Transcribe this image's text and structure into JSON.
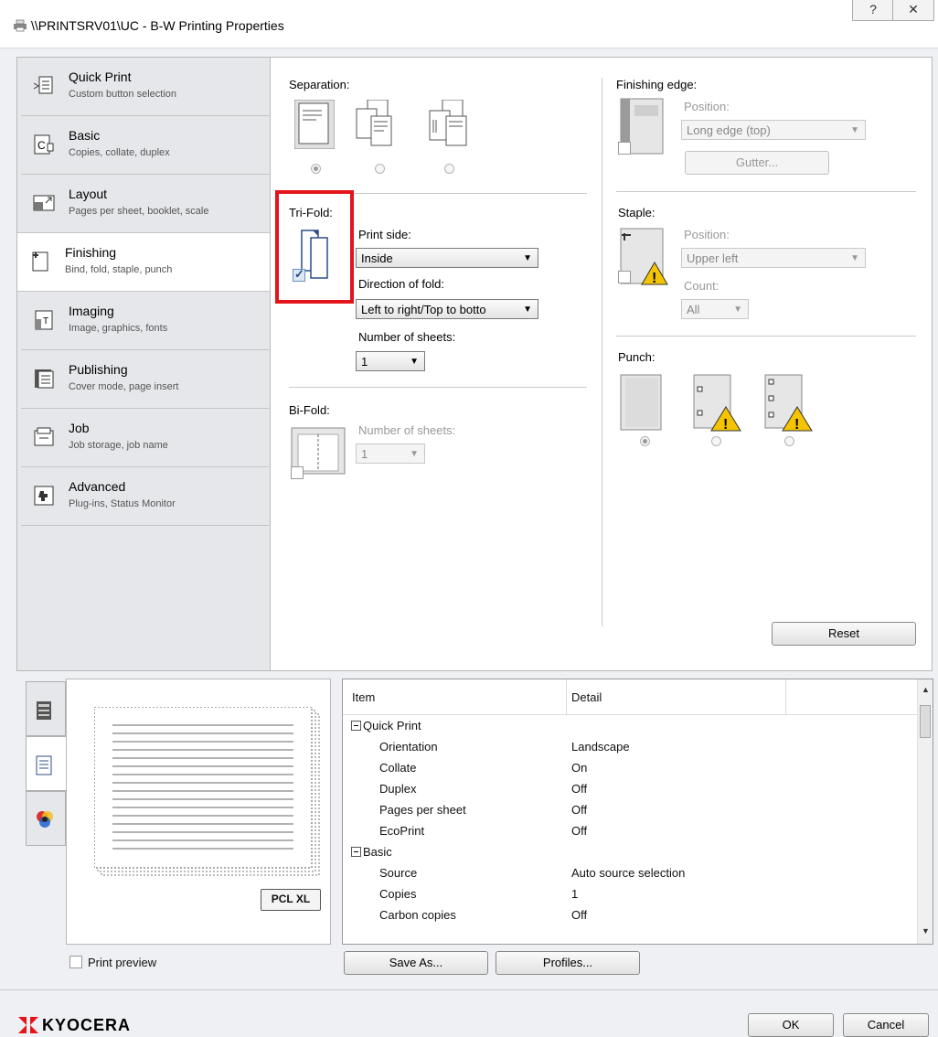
{
  "window": {
    "title": "\\\\PRINTSRV01\\UC - B-W Printing Properties",
    "help_glyph": "?",
    "close_glyph": "✕"
  },
  "nav": [
    {
      "title": "Quick Print",
      "subtitle": "Custom button selection",
      "icon": "quick-print-icon"
    },
    {
      "title": "Basic",
      "subtitle": "Copies, collate, duplex",
      "icon": "basic-icon"
    },
    {
      "title": "Layout",
      "subtitle": "Pages per sheet, booklet, scale",
      "icon": "layout-icon"
    },
    {
      "title": "Finishing",
      "subtitle": "Bind, fold, staple, punch",
      "icon": "finishing-icon",
      "selected": true
    },
    {
      "title": "Imaging",
      "subtitle": "Image, graphics, fonts",
      "icon": "imaging-icon"
    },
    {
      "title": "Publishing",
      "subtitle": "Cover mode, page insert",
      "icon": "publishing-icon"
    },
    {
      "title": "Job",
      "subtitle": "Job storage, job name",
      "icon": "job-icon"
    },
    {
      "title": "Advanced",
      "subtitle": "Plug-ins, Status Monitor",
      "icon": "advanced-icon"
    }
  ],
  "finishing": {
    "separation_label": "Separation:",
    "trifold_label": "Tri-Fold:",
    "print_side_label": "Print side:",
    "print_side_value": "Inside",
    "direction_label": "Direction of fold:",
    "direction_value": "Left to right/Top to botto",
    "tri_sheets_label": "Number of sheets:",
    "tri_sheets_value": "1",
    "bifold_label": "Bi-Fold:",
    "bi_sheets_label": "Number of sheets:",
    "bi_sheets_value": "1",
    "finishing_edge_label": "Finishing edge:",
    "fe_position_label": "Position:",
    "fe_position_value": "Long edge (top)",
    "gutter_label": "Gutter...",
    "staple_label": "Staple:",
    "staple_position_label": "Position:",
    "staple_position_value": "Upper left",
    "count_label": "Count:",
    "count_value": "All",
    "punch_label": "Punch:",
    "reset_label": "Reset"
  },
  "preview": {
    "badge": "PCL XL",
    "print_preview_label": "Print preview"
  },
  "summary": {
    "headers": {
      "item": "Item",
      "detail": "Detail"
    },
    "rows": [
      {
        "group": true,
        "item": "Quick Print",
        "detail": ""
      },
      {
        "item": "Orientation",
        "detail": "Landscape"
      },
      {
        "item": "Collate",
        "detail": "On"
      },
      {
        "item": "Duplex",
        "detail": "Off"
      },
      {
        "item": "Pages per sheet",
        "detail": "Off"
      },
      {
        "item": "EcoPrint",
        "detail": "Off"
      },
      {
        "group": true,
        "item": "Basic",
        "detail": ""
      },
      {
        "item": "Source",
        "detail": "Auto source selection"
      },
      {
        "item": "Copies",
        "detail": "1"
      },
      {
        "item": "Carbon copies",
        "detail": "Off"
      }
    ]
  },
  "buttons": {
    "save_as": "Save As...",
    "profiles": "Profiles...",
    "ok": "OK",
    "cancel": "Cancel"
  },
  "brand": {
    "logo_text": "KYOCERA",
    "accent": "#e3151a"
  }
}
